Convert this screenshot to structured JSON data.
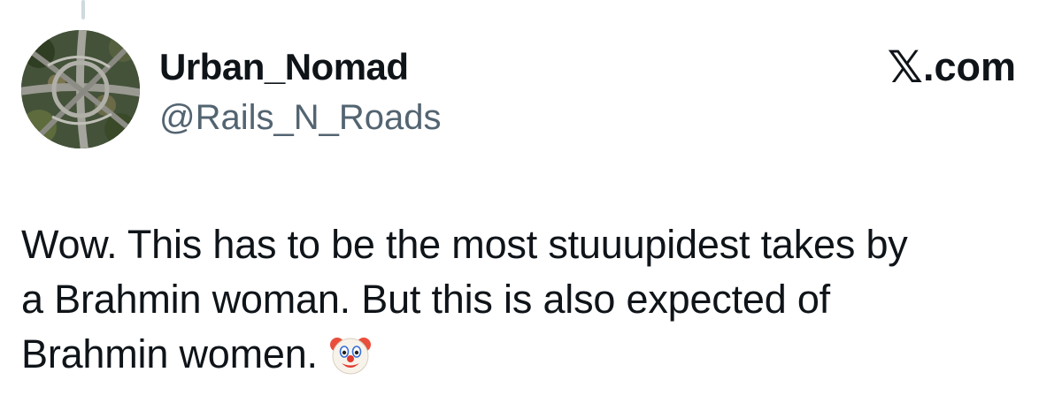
{
  "author": {
    "display_name": "Urban_Nomad",
    "handle": "@Rails_N_Roads",
    "avatar_icon": "highway-interchange-aerial-photo"
  },
  "brand": {
    "logo_icon": "x-logo-icon",
    "logo_text": "𝕏",
    "domain_text": ".com"
  },
  "tweet": {
    "lines": [
      "Wow. This has to be the most stuuupidest takes by",
      "a Brahmin woman. But this is also expected of",
      "Brahmin women."
    ],
    "emoji": "clown-face-emoji"
  }
}
